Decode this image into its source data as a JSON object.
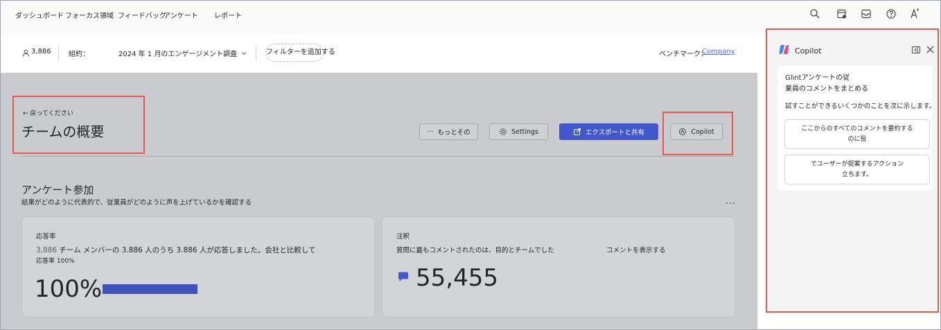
{
  "nav": {
    "items": [
      "ダッシュボード",
      "フォーカス領域",
      "フィードバック",
      "アンケート",
      "レポート"
    ],
    "icons": [
      "search-icon",
      "calendar-icon",
      "inbox-icon",
      "help-icon",
      "accessibility-icon"
    ]
  },
  "filters": {
    "count": "3,886",
    "contract_label": "組約：",
    "survey": "2024 年 1 月のエンゲージメント調査",
    "add_filter": "フィルターを追加する",
    "benchmark_label": "ベンチマーク：",
    "benchmark_value": "Company"
  },
  "header": {
    "back": "戻ってください",
    "title": "チームの概要",
    "more": "もっとその",
    "settings": "Settings",
    "export": "エクスポートと共有",
    "copilot": "Copilot"
  },
  "section": {
    "title": "アンケート参加",
    "subtitle": "結果がどのように代表的で、従業員がどのように声を上げているかを確認する",
    "more": "..."
  },
  "response_card": {
    "label": "応答率",
    "count_prefix": "3,886",
    "line1": " チーム メンバーの 3.886 人のうち 3.886 人が応答しました。会社と比較して",
    "line2": "応答率 100%",
    "rate": "100%",
    "progress": 1.0
  },
  "comments_card": {
    "label": "注釈",
    "line1": "質問に最もコメントされたのは、目的とチームでした",
    "show_link": "コメントを表示する",
    "count": "55,455"
  },
  "copilot": {
    "title": "Copilot",
    "intro1": "Glintアンケートの従",
    "intro2": "業員のコメントをまとめる",
    "prompt": "試すことができるいくつかのことを次に示します。",
    "suggest1_a": "ここからのすべてのコメントを要約する",
    "suggest1_b": "のに役",
    "suggest2_a": "でユーザーが提案するアクション",
    "suggest2_b": "立ちます。"
  },
  "colors": {
    "accent": "#4158cc",
    "highlight": "#e8574c",
    "link": "#4f6bed"
  }
}
